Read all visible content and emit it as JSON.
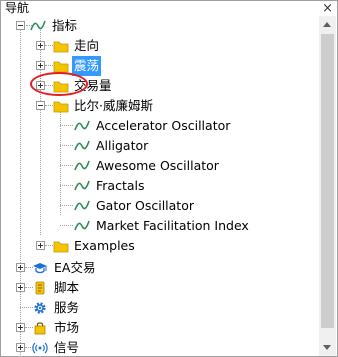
{
  "window": {
    "title": "导航",
    "close_glyph": "×"
  },
  "tree": {
    "indicators": {
      "label": "指标",
      "icon": "indicator-icon"
    },
    "trend": {
      "label": "走向",
      "icon": "folder-icon"
    },
    "oscillators": {
      "label": "震荡",
      "icon": "folder-icon",
      "selected": true
    },
    "volumes": {
      "label": "交易量",
      "icon": "folder-icon"
    },
    "bill_williams": {
      "label": "比尔·威廉姆斯",
      "icon": "folder-icon",
      "items": [
        {
          "label": "Accelerator Oscillator",
          "icon": "indicator-icon"
        },
        {
          "label": "Alligator",
          "icon": "indicator-icon"
        },
        {
          "label": "Awesome Oscillator",
          "icon": "indicator-icon"
        },
        {
          "label": "Fractals",
          "icon": "indicator-icon"
        },
        {
          "label": "Gator Oscillator",
          "icon": "indicator-icon"
        },
        {
          "label": "Market Facilitation Index",
          "icon": "indicator-icon"
        }
      ]
    },
    "examples": {
      "label": "Examples",
      "icon": "folder-icon"
    },
    "expert_advisors": {
      "label": "EA交易",
      "icon": "graduation-cap-icon"
    },
    "scripts": {
      "label": "脚本",
      "icon": "script-icon"
    },
    "services": {
      "label": "服务",
      "icon": "gear-icon"
    },
    "market": {
      "label": "市场",
      "icon": "shopping-bag-icon"
    },
    "signals": {
      "label": "信号",
      "icon": "signal-icon"
    }
  },
  "colors": {
    "selection": "#3399ff",
    "folder": "#f5c400",
    "indicator": "#2e8b57",
    "highlight_ring": "#e51c23",
    "accent_blue": "#1e6fd0"
  }
}
